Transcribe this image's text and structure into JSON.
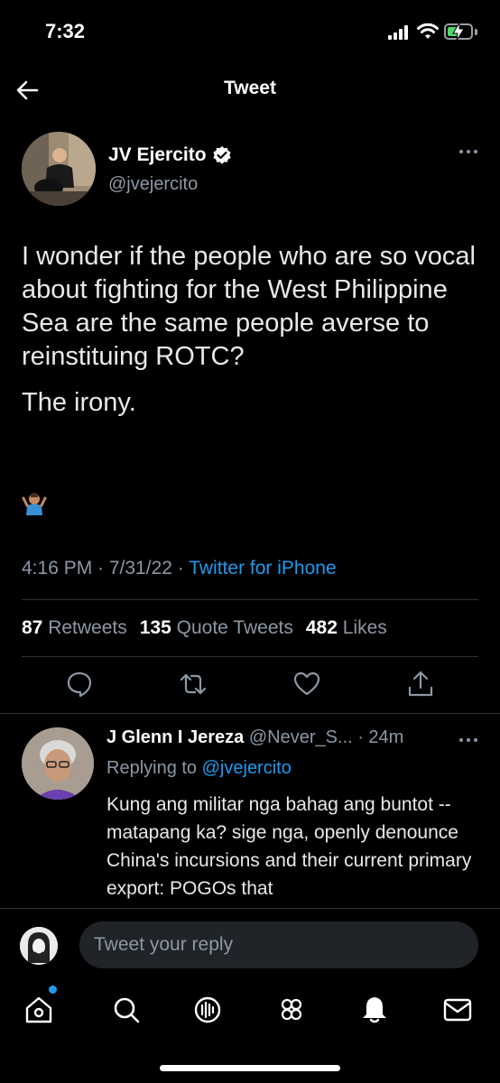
{
  "status_bar": {
    "time": "7:32"
  },
  "header": {
    "title": "Tweet"
  },
  "tweet": {
    "author_name": "JV Ejercito",
    "author_handle": "@jvejercito",
    "paragraphs": [
      "I wonder if the people who are so vocal about fighting for the West Philippine Sea are the same people averse to reinstituing ROTC?",
      "The irony."
    ],
    "emoji": "shrug-emoji",
    "timestamp": "4:16 PM · 7/31/22 · ",
    "source": "Twitter for iPhone",
    "stats": {
      "retweets_count": "87",
      "retweets_label": "Retweets",
      "quotes_count": "135",
      "quotes_label": "Quote Tweets",
      "likes_count": "482",
      "likes_label": "Likes"
    }
  },
  "reply": {
    "author_name": "J Glenn I Jereza",
    "author_handle": "@Never_S...",
    "time": " · 24m",
    "replying_label": "Replying to ",
    "replying_handle": "@jvejercito",
    "text": "Kung ang militar nga bahag ang buntot -- matapang ka? sige nga, openly denounce China's incursions and their current primary export: POGOs that"
  },
  "composer": {
    "placeholder": "Tweet your reply"
  },
  "tabbar": {
    "items": [
      "home-icon",
      "search-icon",
      "spaces-icon",
      "communities-icon",
      "notifications-icon",
      "messages-icon"
    ]
  },
  "colors": {
    "accent": "#1d9bf0",
    "background": "#000000",
    "muted": "#8b98a5"
  }
}
